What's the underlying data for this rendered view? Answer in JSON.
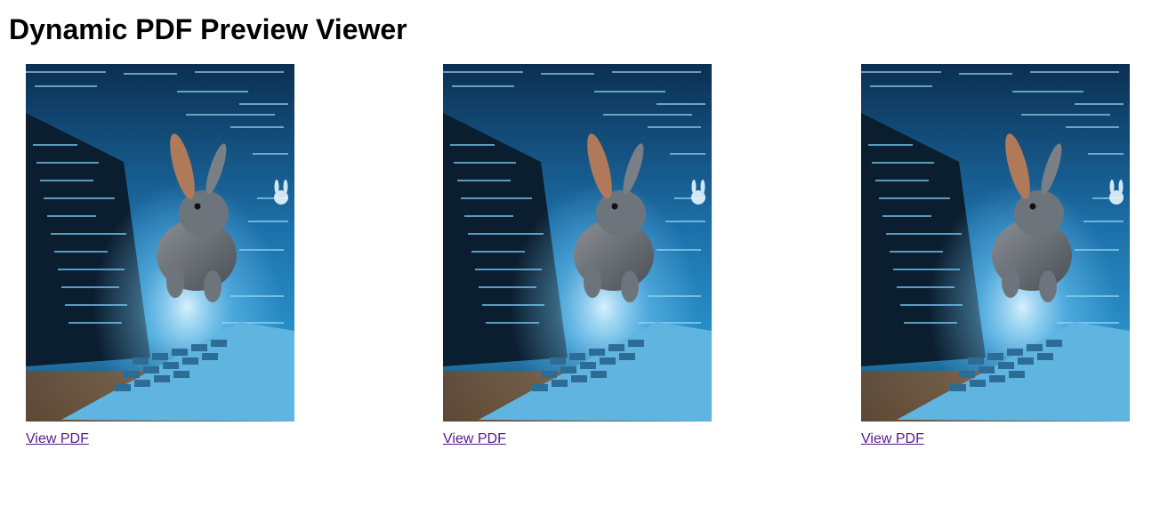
{
  "page": {
    "title": "Dynamic PDF Preview Viewer"
  },
  "previews": [
    {
      "link_label": "View PDF",
      "thumbnail_icon": "rabbit-laptop-image"
    },
    {
      "link_label": "View PDF",
      "thumbnail_icon": "rabbit-laptop-image"
    },
    {
      "link_label": "View PDF",
      "thumbnail_icon": "rabbit-laptop-image"
    }
  ],
  "colors": {
    "link_visited": "#551a8b",
    "title": "#000000",
    "background": "#ffffff"
  }
}
